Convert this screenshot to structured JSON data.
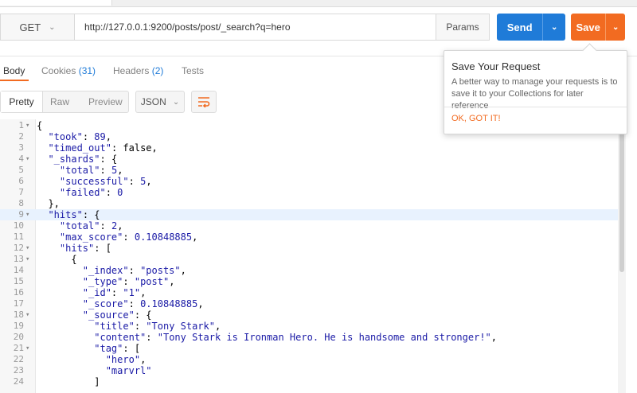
{
  "request": {
    "method": "GET",
    "url": "http://127.0.0.1:9200/posts/post/_search?q=hero",
    "params_label": "Params",
    "send_label": "Send",
    "save_label": "Save"
  },
  "response_tabs": [
    {
      "label": "Body",
      "count": ""
    },
    {
      "label": "Cookies",
      "count": "(31)"
    },
    {
      "label": "Headers",
      "count": "(2)"
    },
    {
      "label": "Tests",
      "count": ""
    }
  ],
  "view": {
    "pretty": "Pretty",
    "raw": "Raw",
    "preview": "Preview",
    "format": "JSON"
  },
  "popover": {
    "title": "Save Your Request",
    "body": "A better way to manage your requests is to save it to your Collections for later reference",
    "ok": "OK, GOT IT!"
  },
  "code_lines": [
    {
      "n": "1",
      "fold": true,
      "text": "{"
    },
    {
      "n": "2",
      "fold": false,
      "text": "  \"took\": 89,"
    },
    {
      "n": "3",
      "fold": false,
      "text": "  \"timed_out\": false,"
    },
    {
      "n": "4",
      "fold": true,
      "text": "  \"_shards\": {"
    },
    {
      "n": "5",
      "fold": false,
      "text": "    \"total\": 5,"
    },
    {
      "n": "6",
      "fold": false,
      "text": "    \"successful\": 5,"
    },
    {
      "n": "7",
      "fold": false,
      "text": "    \"failed\": 0"
    },
    {
      "n": "8",
      "fold": false,
      "text": "  },"
    },
    {
      "n": "9",
      "fold": true,
      "text": "  \"hits\": {"
    },
    {
      "n": "10",
      "fold": false,
      "text": "    \"total\": 2,"
    },
    {
      "n": "11",
      "fold": false,
      "text": "    \"max_score\": 0.10848885,"
    },
    {
      "n": "12",
      "fold": true,
      "text": "    \"hits\": ["
    },
    {
      "n": "13",
      "fold": true,
      "text": "      {"
    },
    {
      "n": "14",
      "fold": false,
      "text": "        \"_index\": \"posts\","
    },
    {
      "n": "15",
      "fold": false,
      "text": "        \"_type\": \"post\","
    },
    {
      "n": "16",
      "fold": false,
      "text": "        \"_id\": \"1\","
    },
    {
      "n": "17",
      "fold": false,
      "text": "        \"_score\": 0.10848885,"
    },
    {
      "n": "18",
      "fold": true,
      "text": "        \"_source\": {"
    },
    {
      "n": "19",
      "fold": false,
      "text": "          \"title\": \"Tony Stark\","
    },
    {
      "n": "20",
      "fold": false,
      "text": "          \"content\": \"Tony Stark is Ironman Hero. He is handsome and stronger!\","
    },
    {
      "n": "21",
      "fold": true,
      "text": "          \"tag\": ["
    },
    {
      "n": "22",
      "fold": false,
      "text": "            \"hero\","
    },
    {
      "n": "23",
      "fold": false,
      "text": "            \"marvrl\""
    },
    {
      "n": "24",
      "fold": false,
      "text": "          ]"
    }
  ],
  "highlighted_line": "9"
}
